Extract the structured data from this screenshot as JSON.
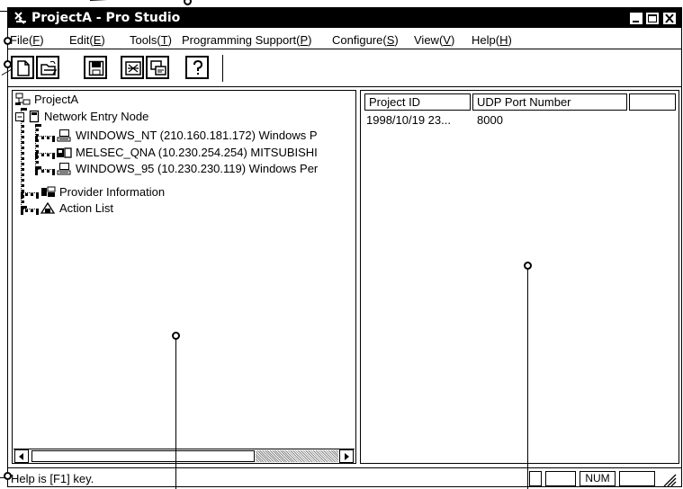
{
  "window": {
    "title": "ProjectA - Pro Studio",
    "controls": [
      "minimize",
      "maximize",
      "close"
    ]
  },
  "menubar": {
    "items": [
      {
        "label": "File(",
        "key": "F",
        "tail": ")"
      },
      {
        "label": "Edit(",
        "key": "E",
        "tail": ")"
      },
      {
        "label": "Tools(",
        "key": "T",
        "tail": ")"
      },
      {
        "label": "Programming Support(",
        "key": "P",
        "tail": ")"
      },
      {
        "label": "Configure(",
        "key": "S",
        "tail": ")"
      },
      {
        "label": "View(",
        "key": "V",
        "tail": ")"
      },
      {
        "label": "Help(",
        "key": "H",
        "tail": ")"
      }
    ]
  },
  "toolbar": {
    "buttons": [
      "new-file-icon",
      "open-folder-icon",
      "save-disk-icon",
      "transfer-icon",
      "monitor-icon",
      "help-icon"
    ]
  },
  "tree": {
    "root": "ProjectA",
    "network_node": "Network Entry Node",
    "nodes": [
      "WINDOWS_NT (210.160.181.172) Windows P",
      "MELSEC_QNA (10.230.254.254) MITSUBISHI",
      "WINDOWS_95 (10.230.230.119) Windows Per"
    ],
    "provider": "Provider Information",
    "action_list": "Action List"
  },
  "table": {
    "columns": [
      "Project ID",
      "UDP Port Number",
      ""
    ],
    "rows": [
      [
        "1998/10/19 23...",
        "8000"
      ]
    ]
  },
  "status": {
    "text": "Help is [F1] key.",
    "indicators": [
      "",
      "",
      "NUM",
      ""
    ]
  }
}
